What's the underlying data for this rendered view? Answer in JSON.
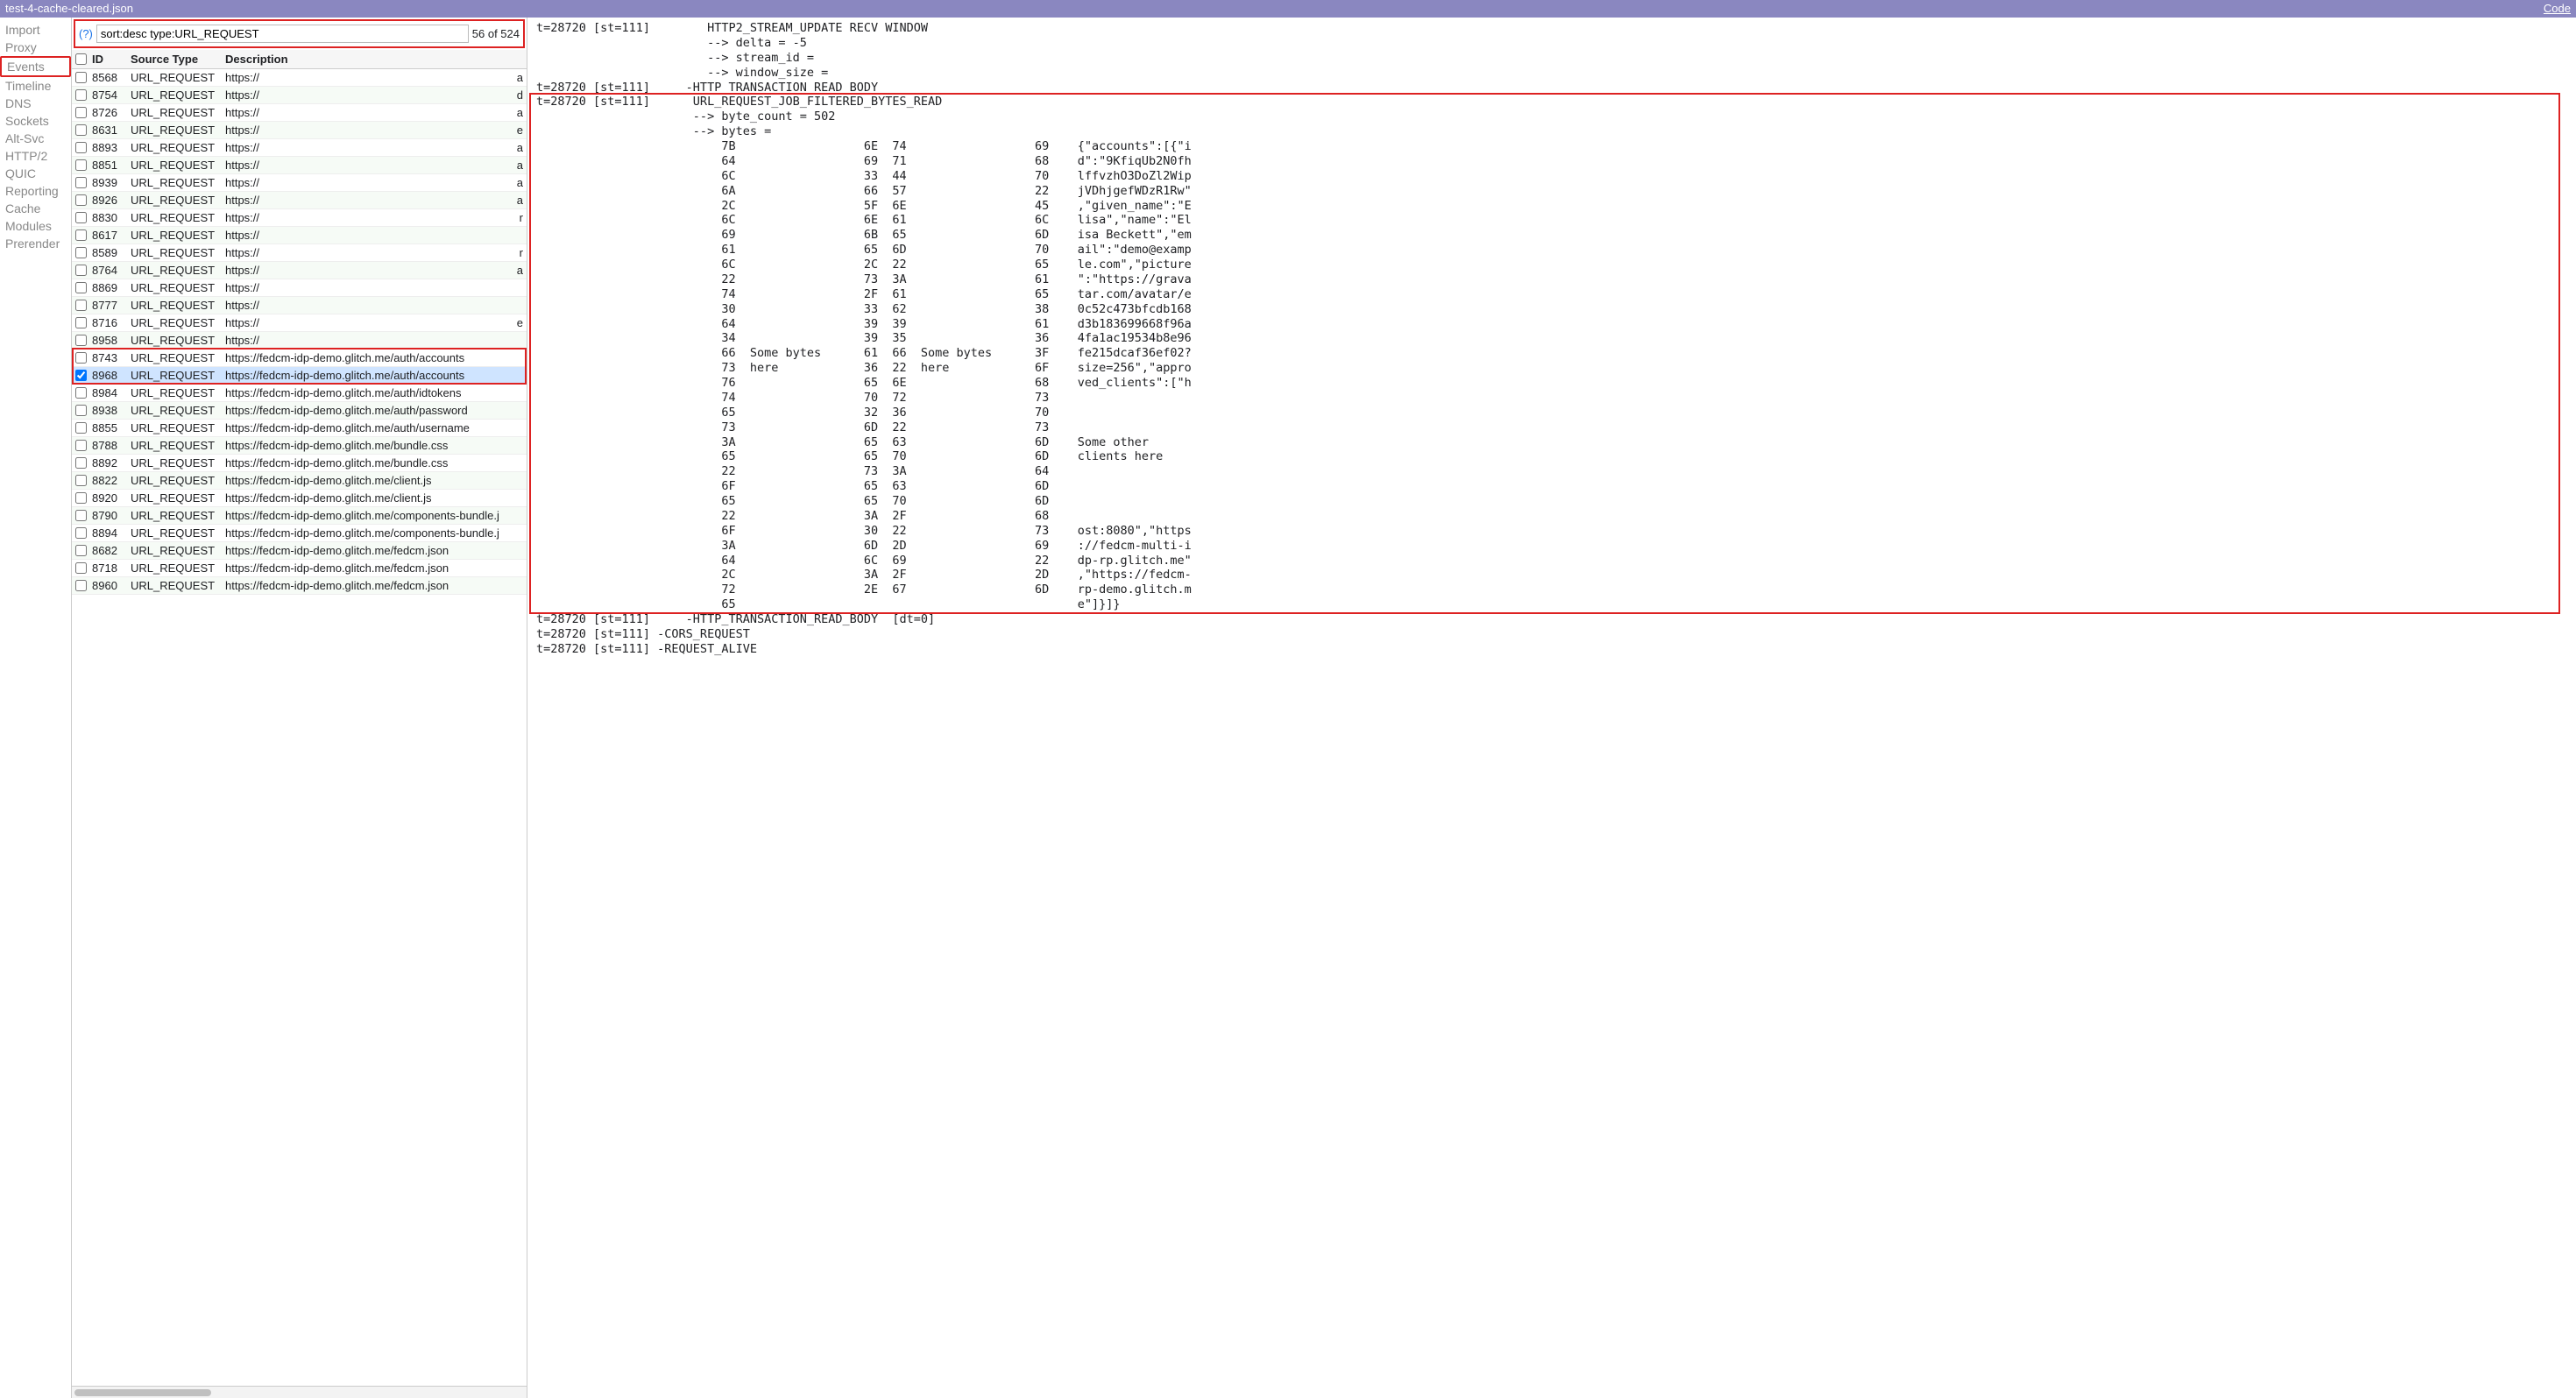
{
  "title": "test-4-cache-cleared.json",
  "code_link": "Code",
  "sidebar": {
    "items": [
      {
        "label": "Import",
        "active": false
      },
      {
        "label": "Proxy",
        "active": false
      },
      {
        "label": "Events",
        "active": true
      },
      {
        "label": "Timeline",
        "active": false
      },
      {
        "label": "DNS",
        "active": false
      },
      {
        "label": "Sockets",
        "active": false
      },
      {
        "label": "Alt-Svc",
        "active": false
      },
      {
        "label": "HTTP/2",
        "active": false
      },
      {
        "label": "QUIC",
        "active": false
      },
      {
        "label": "Reporting",
        "active": false
      },
      {
        "label": "Cache",
        "active": false
      },
      {
        "label": "Modules",
        "active": false
      },
      {
        "label": "Prerender",
        "active": false
      }
    ]
  },
  "filter": {
    "help": "(?)",
    "value": "sort:desc type:URL_REQUEST",
    "count": "56 of 524"
  },
  "table": {
    "headers": {
      "id": "ID",
      "type": "Source Type",
      "desc": "Description"
    },
    "rows": [
      {
        "id": "8568",
        "type": "URL_REQUEST",
        "desc": "https://",
        "checked": false,
        "sel": false,
        "extra": "a"
      },
      {
        "id": "8754",
        "type": "URL_REQUEST",
        "desc": "https://",
        "checked": false,
        "sel": false,
        "extra": "d"
      },
      {
        "id": "8726",
        "type": "URL_REQUEST",
        "desc": "https://",
        "checked": false,
        "sel": false,
        "extra": "a"
      },
      {
        "id": "8631",
        "type": "URL_REQUEST",
        "desc": "https://",
        "checked": false,
        "sel": false,
        "extra": "e"
      },
      {
        "id": "8893",
        "type": "URL_REQUEST",
        "desc": "https://",
        "checked": false,
        "sel": false,
        "extra": "a"
      },
      {
        "id": "8851",
        "type": "URL_REQUEST",
        "desc": "https://",
        "checked": false,
        "sel": false,
        "extra": "a"
      },
      {
        "id": "8939",
        "type": "URL_REQUEST",
        "desc": "https://",
        "checked": false,
        "sel": false,
        "extra": "a"
      },
      {
        "id": "8926",
        "type": "URL_REQUEST",
        "desc": "https://",
        "checked": false,
        "sel": false,
        "extra": "a"
      },
      {
        "id": "8830",
        "type": "URL_REQUEST",
        "desc": "https://",
        "checked": false,
        "sel": false,
        "extra": "r"
      },
      {
        "id": "8617",
        "type": "URL_REQUEST",
        "desc": "https://",
        "checked": false,
        "sel": false,
        "extra": ""
      },
      {
        "id": "8589",
        "type": "URL_REQUEST",
        "desc": "https://",
        "checked": false,
        "sel": false,
        "extra": "r"
      },
      {
        "id": "8764",
        "type": "URL_REQUEST",
        "desc": "https://",
        "checked": false,
        "sel": false,
        "extra": "a"
      },
      {
        "id": "8869",
        "type": "URL_REQUEST",
        "desc": "https://",
        "checked": false,
        "sel": false,
        "extra": ""
      },
      {
        "id": "8777",
        "type": "URL_REQUEST",
        "desc": "https://",
        "checked": false,
        "sel": false,
        "extra": ""
      },
      {
        "id": "8716",
        "type": "URL_REQUEST",
        "desc": "https://",
        "checked": false,
        "sel": false,
        "extra": "e"
      },
      {
        "id": "8958",
        "type": "URL_REQUEST",
        "desc": "https://",
        "checked": false,
        "sel": false,
        "extra": ""
      },
      {
        "id": "8743",
        "type": "URL_REQUEST",
        "desc": "https://fedcm-idp-demo.glitch.me/auth/accounts",
        "checked": false,
        "sel": false,
        "hl": true
      },
      {
        "id": "8968",
        "type": "URL_REQUEST",
        "desc": "https://fedcm-idp-demo.glitch.me/auth/accounts",
        "checked": true,
        "sel": true,
        "hl": true
      },
      {
        "id": "8984",
        "type": "URL_REQUEST",
        "desc": "https://fedcm-idp-demo.glitch.me/auth/idtokens",
        "checked": false,
        "sel": false
      },
      {
        "id": "8938",
        "type": "URL_REQUEST",
        "desc": "https://fedcm-idp-demo.glitch.me/auth/password",
        "checked": false,
        "sel": false
      },
      {
        "id": "8855",
        "type": "URL_REQUEST",
        "desc": "https://fedcm-idp-demo.glitch.me/auth/username",
        "checked": false,
        "sel": false
      },
      {
        "id": "8788",
        "type": "URL_REQUEST",
        "desc": "https://fedcm-idp-demo.glitch.me/bundle.css",
        "checked": false,
        "sel": false
      },
      {
        "id": "8892",
        "type": "URL_REQUEST",
        "desc": "https://fedcm-idp-demo.glitch.me/bundle.css",
        "checked": false,
        "sel": false
      },
      {
        "id": "8822",
        "type": "URL_REQUEST",
        "desc": "https://fedcm-idp-demo.glitch.me/client.js",
        "checked": false,
        "sel": false
      },
      {
        "id": "8920",
        "type": "URL_REQUEST",
        "desc": "https://fedcm-idp-demo.glitch.me/client.js",
        "checked": false,
        "sel": false
      },
      {
        "id": "8790",
        "type": "URL_REQUEST",
        "desc": "https://fedcm-idp-demo.glitch.me/components-bundle.j",
        "checked": false,
        "sel": false
      },
      {
        "id": "8894",
        "type": "URL_REQUEST",
        "desc": "https://fedcm-idp-demo.glitch.me/components-bundle.j",
        "checked": false,
        "sel": false
      },
      {
        "id": "8682",
        "type": "URL_REQUEST",
        "desc": "https://fedcm-idp-demo.glitch.me/fedcm.json",
        "checked": false,
        "sel": false
      },
      {
        "id": "8718",
        "type": "URL_REQUEST",
        "desc": "https://fedcm-idp-demo.glitch.me/fedcm.json",
        "checked": false,
        "sel": false
      },
      {
        "id": "8960",
        "type": "URL_REQUEST",
        "desc": "https://fedcm-idp-demo.glitch.me/fedcm.json",
        "checked": false,
        "sel": false
      }
    ]
  },
  "detail": {
    "prelines": [
      "t=28720 [st=111]        HTTP2_STREAM_UPDATE RECV WINDOW",
      "                        --> delta = -5",
      "                        --> stream_id = ",
      "                        --> window_size = ",
      "t=28720 [st=111]     -HTTP_TRANSACTION_READ_BODY"
    ],
    "head": [
      "t=28720 [st=111]      URL_REQUEST_JOB_FILTERED_BYTES_READ",
      "                      --> byte_count = 502",
      "                      --> bytes ="
    ],
    "hex": [
      {
        "c1": "7B",
        "c3": "6E  74",
        "c5": "69",
        "txt": "{\"accounts\":[{\"i"
      },
      {
        "c1": "64",
        "c3": "69  71",
        "c5": "68",
        "txt": "d\":\"9KfiqUb2N0fh"
      },
      {
        "c1": "6C",
        "c3": "33  44",
        "c5": "70",
        "txt": "lffvzhO3DoZl2Wip"
      },
      {
        "c1": "6A",
        "c3": "66  57",
        "c5": "22",
        "txt": "jVDhjgefWDzR1Rw\""
      },
      {
        "c1": "2C",
        "c3": "5F  6E",
        "c5": "45",
        "txt": ",\"given_name\":\"E"
      },
      {
        "c1": "6C",
        "c3": "6E  61",
        "c5": "6C",
        "txt": "lisa\",\"name\":\"El"
      },
      {
        "c1": "69",
        "c3": "6B  65",
        "c5": "6D",
        "txt": "isa Beckett\",\"em"
      },
      {
        "c1": "61",
        "c3": "65  6D",
        "c5": "70",
        "txt": "ail\":\"demo@examp"
      },
      {
        "c1": "6C",
        "c3": "2C  22",
        "c5": "65",
        "txt": "le.com\",\"picture"
      },
      {
        "c1": "22",
        "c3": "73  3A",
        "c5": "61",
        "txt": "\":\"https://grava"
      },
      {
        "c1": "74",
        "c3": "2F  61",
        "c5": "65",
        "txt": "tar.com/avatar/e"
      },
      {
        "c1": "30",
        "c3": "33  62",
        "c5": "38",
        "txt": "0c52c473bfcdb168"
      },
      {
        "c1": "64",
        "c3": "39  39",
        "c5": "61",
        "txt": "d3b183699668f96a"
      },
      {
        "c1": "34",
        "c3": "39  35",
        "c5": "36",
        "txt": "4fa1ac19534b8e96"
      },
      {
        "c1": "66",
        "mid1": "Some bytes",
        "c3": "61  66",
        "mid2": "Some bytes",
        "c5": "3F",
        "txt": "fe215dcaf36ef02?"
      },
      {
        "c1": "73",
        "mid1": "here",
        "c3": "36  22",
        "mid2": "here",
        "c5": "6F",
        "txt": "size=256\",\"appro"
      },
      {
        "c1": "76",
        "c3": "65  6E",
        "c5": "68",
        "txt": "ved_clients\":[\"h"
      },
      {
        "c1": "74",
        "c3": "70  72",
        "c5": "73",
        "txt": ""
      },
      {
        "c1": "65",
        "c3": "32  36",
        "c5": "70",
        "txt": ""
      },
      {
        "c1": "73",
        "c3": "6D  22",
        "c5": "73",
        "txt": ""
      },
      {
        "c1": "3A",
        "c3": "65  63",
        "c5": "6D",
        "txt": "Some other"
      },
      {
        "c1": "65",
        "c3": "65  70",
        "c5": "6D",
        "txt": "clients here"
      },
      {
        "c1": "22",
        "c3": "73  3A",
        "c5": "64",
        "txt": ""
      },
      {
        "c1": "6F",
        "c3": "65  63",
        "c5": "6D",
        "txt": ""
      },
      {
        "c1": "65",
        "c3": "65  70",
        "c5": "6D",
        "txt": ""
      },
      {
        "c1": "22",
        "c3": "3A  2F",
        "c5": "68",
        "txt": ""
      },
      {
        "c1": "6F",
        "c3": "30  22",
        "c5": "73",
        "txt": "ost:8080\",\"https"
      },
      {
        "c1": "3A",
        "c3": "6D  2D",
        "c5": "69",
        "txt": "://fedcm-multi-i"
      },
      {
        "c1": "64",
        "c3": "6C  69",
        "c5": "22",
        "txt": "dp-rp.glitch.me\""
      },
      {
        "c1": "2C",
        "c3": "3A  2F",
        "c5": "2D",
        "txt": ",\"https://fedcm-"
      },
      {
        "c1": "72",
        "c3": "2E  67",
        "c5": "6D",
        "txt": "rp-demo.glitch.m"
      },
      {
        "c1": "65",
        "c3": "",
        "c5": "",
        "txt": "e\"]}]}"
      }
    ],
    "postlines": [
      "t=28720 [st=111]     -HTTP_TRANSACTION_READ_BODY  [dt=0]",
      "t=28720 [st=111] -CORS_REQUEST",
      "t=28720 [st=111] -REQUEST_ALIVE"
    ]
  }
}
